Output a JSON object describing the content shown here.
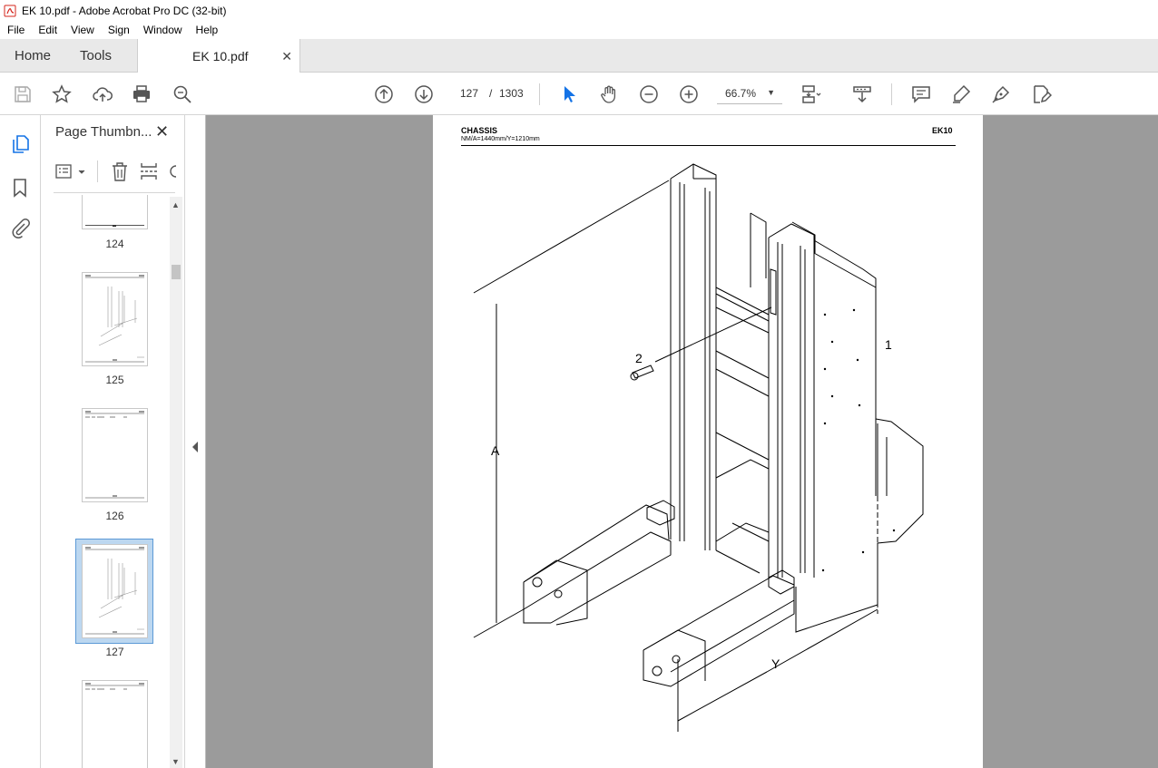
{
  "window": {
    "title": "EK 10.pdf - Adobe Acrobat Pro DC (32-bit)"
  },
  "menu": {
    "items": [
      "File",
      "Edit",
      "View",
      "Sign",
      "Window",
      "Help"
    ]
  },
  "tabs": {
    "home": "Home",
    "tools": "Tools",
    "document": "EK 10.pdf"
  },
  "toolbar": {
    "current_page": "127",
    "page_separator": "/",
    "total_pages": "1303",
    "zoom": "66.7%"
  },
  "thumbnails_panel": {
    "title": "Page Thumbn...",
    "pages": [
      {
        "label": "124"
      },
      {
        "label": "125"
      },
      {
        "label": "126"
      },
      {
        "label": "127",
        "selected": true
      },
      {
        "label": ""
      }
    ]
  },
  "document_page": {
    "header_title": "CHASSIS",
    "header_subtitle": "NM/A=1440mm/Y=1210mm",
    "header_model": "EK10",
    "callouts": {
      "c1": "1",
      "c2": "2",
      "cA": "A",
      "cY": "Y"
    }
  },
  "colors": {
    "accent_blue": "#1473e6",
    "doc_background": "#9b9b9b",
    "selected_thumb": "#bcd7f0"
  }
}
